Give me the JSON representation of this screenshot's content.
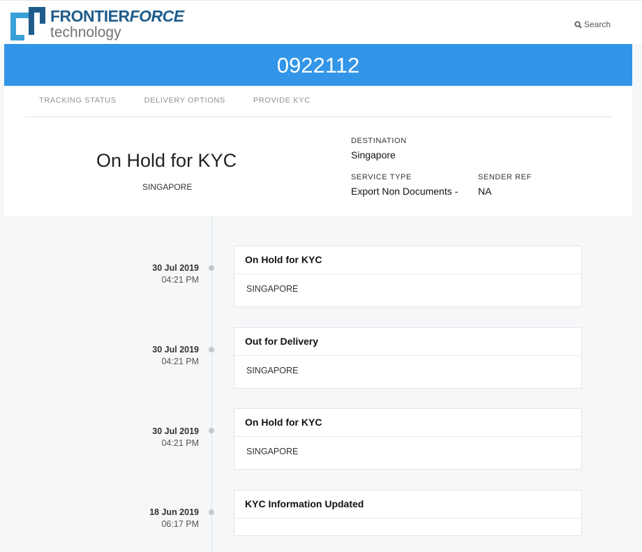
{
  "header": {
    "logo_primary": "FRONTIER",
    "logo_accent": "FORCE",
    "logo_sub": "technology",
    "search_label": "Search",
    "search_icon": "search-icon"
  },
  "banner": {
    "tracking_number": "0922112"
  },
  "tabs": [
    {
      "label": "TRACKING STATUS"
    },
    {
      "label": "DELIVERY OPTIONS"
    },
    {
      "label": "PROVIDE KYC"
    }
  ],
  "summary": {
    "status": "On Hold for KYC",
    "location": "SINGAPORE",
    "destination_label": "DESTINATION",
    "destination": "Singapore",
    "service_type_label": "SERVICE TYPE",
    "service_type": "Export Non Documents -",
    "sender_ref_label": "SENDER REF",
    "sender_ref": "NA"
  },
  "events": [
    {
      "date": "30 Jul 2019",
      "time": "04:21 PM",
      "title": "On Hold for KYC",
      "location": "SINGAPORE"
    },
    {
      "date": "30 Jul 2019",
      "time": "04:21 PM",
      "title": "Out for Delivery",
      "location": "SINGAPORE"
    },
    {
      "date": "30 Jul 2019",
      "time": "04:21 PM",
      "title": "On Hold for KYC",
      "location": "SINGAPORE"
    },
    {
      "date": "18 Jun 2019",
      "time": "06:17 PM",
      "title": "KYC Information Updated",
      "location": ""
    }
  ],
  "colors": {
    "banner": "#3295e8",
    "logo_blue": "#1f5c8b",
    "logo_light": "#3aa0d8",
    "page_bg": "#f5f7f8"
  }
}
